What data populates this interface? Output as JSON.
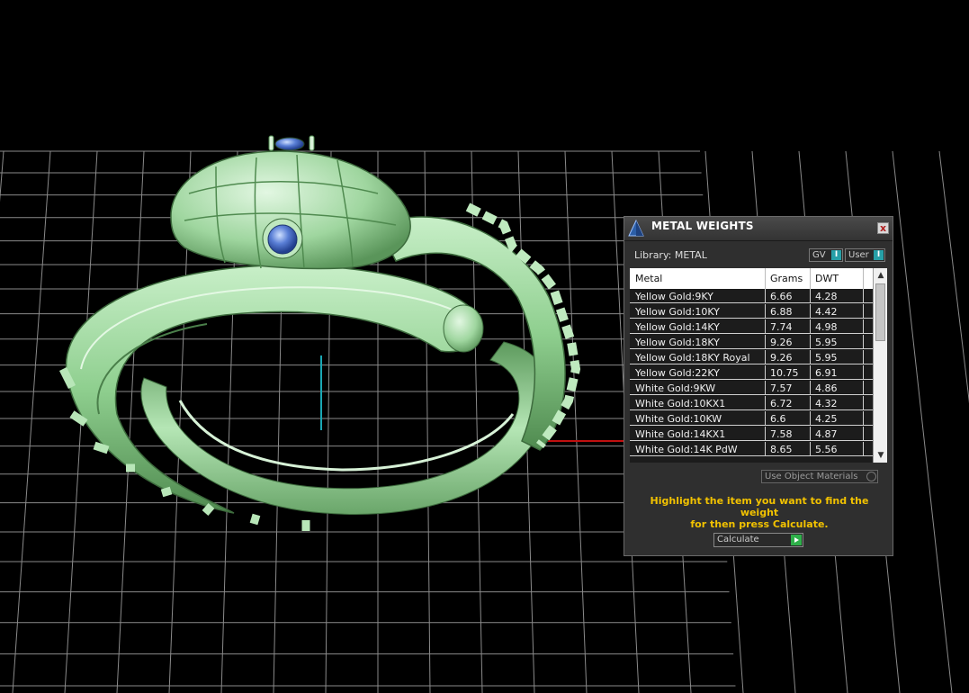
{
  "panel": {
    "title": "METAL WEIGHTS",
    "close_label": "x",
    "library_label": "Library: METAL",
    "toggles": [
      {
        "label": "GV",
        "indicator": "I"
      },
      {
        "label": "User",
        "indicator": "I"
      }
    ],
    "table": {
      "headers": [
        "Metal",
        "Grams",
        "DWT"
      ],
      "rows": [
        [
          "Yellow Gold:9KY",
          "6.66",
          "4.28"
        ],
        [
          "Yellow Gold:10KY",
          "6.88",
          "4.42"
        ],
        [
          "Yellow Gold:14KY",
          "7.74",
          "4.98"
        ],
        [
          "Yellow Gold:18KY",
          "9.26",
          "5.95"
        ],
        [
          "Yellow Gold:18KY Royal",
          "9.26",
          "5.95"
        ],
        [
          "Yellow Gold:22KY",
          "10.75",
          "6.91"
        ],
        [
          "White Gold:9KW",
          "7.57",
          "4.86"
        ],
        [
          "White Gold:10KX1",
          "6.72",
          "4.32"
        ],
        [
          "White Gold:10KW",
          "6.6",
          "4.25"
        ],
        [
          "White Gold:14KX1",
          "7.58",
          "4.87"
        ],
        [
          "White Gold:14K PdW",
          "8.65",
          "5.56"
        ]
      ]
    },
    "use_object_materials_label": "Use Object Materials",
    "hint_line1": "Highlight the item you want to find the weight",
    "hint_line2": "for then press Calculate.",
    "calculate_label": "Calculate"
  },
  "colors": {
    "model_green": "#9fd69f",
    "hint_yellow": "#f2c200",
    "toggle_teal": "#27a0a8"
  }
}
